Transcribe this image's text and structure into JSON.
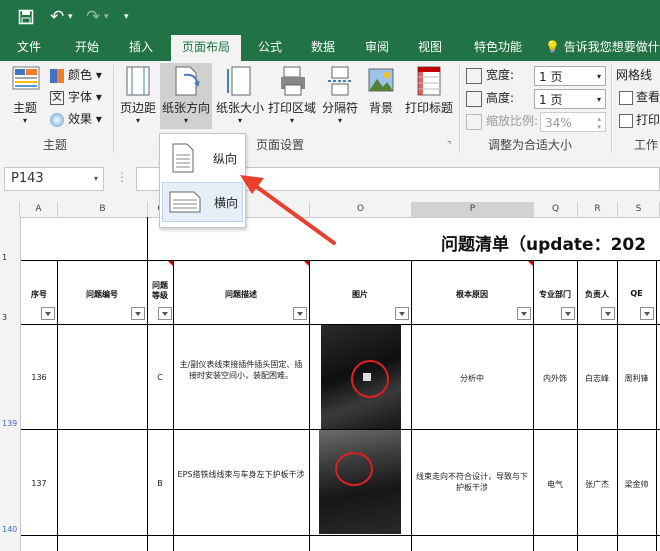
{
  "quick_access": {
    "undo_label": "↶",
    "redo_label": "↷"
  },
  "tabs": [
    "文件",
    "开始",
    "插入",
    "页面布局",
    "公式",
    "数据",
    "审阅",
    "视图",
    "特色功能"
  ],
  "tell_me": "告诉我您想要做什",
  "ribbon": {
    "theme": {
      "button": "主题",
      "colors": "颜色",
      "fonts": "字体",
      "effects": "效果",
      "group": "主题"
    },
    "page_setup": {
      "margins": "页边距",
      "orientation": "纸张方向",
      "size": "纸张大小",
      "print_area": "打印区域",
      "breaks": "分隔符",
      "background": "背景",
      "print_titles": "打印标题",
      "group": "页面设置"
    },
    "scale": {
      "width_label": "宽度:",
      "width_value": "1 页",
      "height_label": "高度:",
      "height_value": "1 页",
      "scale_label": "缩放比例:",
      "scale_value": "34%",
      "group": "调整为合适大小"
    },
    "sheet_options": {
      "gridlines": "网格线",
      "view": "查看",
      "print": "打印",
      "group": "工作"
    }
  },
  "orientation_menu": {
    "portrait": "纵向",
    "landscape": "横向"
  },
  "name_box": "P143",
  "columns": [
    "A",
    "B",
    "C",
    "D",
    "O",
    "P",
    "Q",
    "R",
    "S"
  ],
  "row_numbers": [
    "1",
    "3",
    "139",
    "140"
  ],
  "sheet": {
    "title": "问题清单（update：202",
    "headers": [
      "序号",
      "问题编号",
      "问题等级",
      "问题描述",
      "图片",
      "根本原因",
      "专业部门",
      "负责人",
      "QE"
    ],
    "rows": [
      {
        "no": "136",
        "level": "C",
        "desc": "主/副仪表线束接插件插头固定、插接时安装空间小，装配困难。",
        "cause": "分析中",
        "dept": "内外饰",
        "owner": "白志峰",
        "qe": "周利锋"
      },
      {
        "no": "137",
        "level": "B",
        "desc": "EPS搭铁线线束与车身左下护板干涉",
        "cause": "线束走向不符合设计，导致与下护板干涉",
        "dept": "电气",
        "owner": "张广杰",
        "qe": "梁金帅"
      }
    ]
  },
  "colors": {
    "excel_green": "#217346",
    "ribbon_bg": "#f3f3f3",
    "arrow_red": "#e8402c"
  }
}
